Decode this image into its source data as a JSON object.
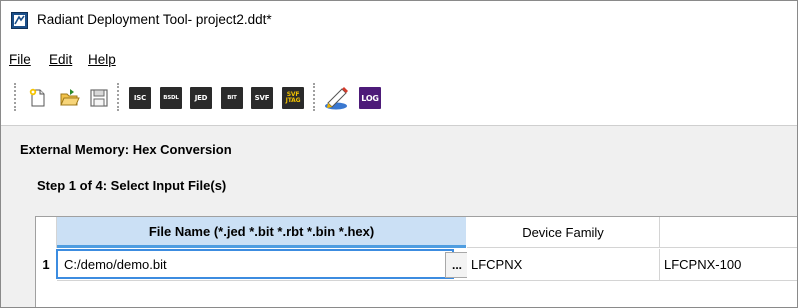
{
  "window": {
    "title": "Radiant Deployment Tool- project2.ddt*"
  },
  "menu": {
    "items": [
      {
        "label": "File"
      },
      {
        "label": "Edit"
      },
      {
        "label": "Help"
      }
    ]
  },
  "toolbar": {
    "buttons": [
      {
        "icon": "new-file-icon"
      },
      {
        "icon": "open-folder-icon"
      },
      {
        "icon": "save-icon"
      },
      {
        "icon": "isc-icon",
        "label": "ISC"
      },
      {
        "icon": "bsdl-icon",
        "label": "BSDL"
      },
      {
        "icon": "jed-icon",
        "label": "JED"
      },
      {
        "icon": "bit-icon",
        "label": "BIT"
      },
      {
        "icon": "svf-icon",
        "label": "SVF"
      },
      {
        "icon": "svf-jtag-icon",
        "label": "SVF JTAG"
      },
      {
        "icon": "edit-wand-icon"
      },
      {
        "icon": "log-icon",
        "label": "LOG"
      }
    ]
  },
  "panel": {
    "section_title": "External Memory:  Hex Conversion",
    "step_title": "Step 1 of 4: Select Input File(s)"
  },
  "grid": {
    "columns": [
      {
        "label": "File Name (*.jed *.bit *.rbt *.bin *.hex)"
      },
      {
        "label": "Device Family"
      },
      {
        "label": ""
      }
    ],
    "rows": [
      {
        "num": "1",
        "file": "C:/demo/demo.bit",
        "family": "LFCPNX",
        "device": "LFCPNX-100"
      }
    ],
    "browse_label": "..."
  },
  "colors": {
    "active_header_bg": "#cbe0f5",
    "active_header_border": "#4f9de0",
    "panel_bg": "#f0f0f0",
    "log_purple": "#4d1b79"
  }
}
